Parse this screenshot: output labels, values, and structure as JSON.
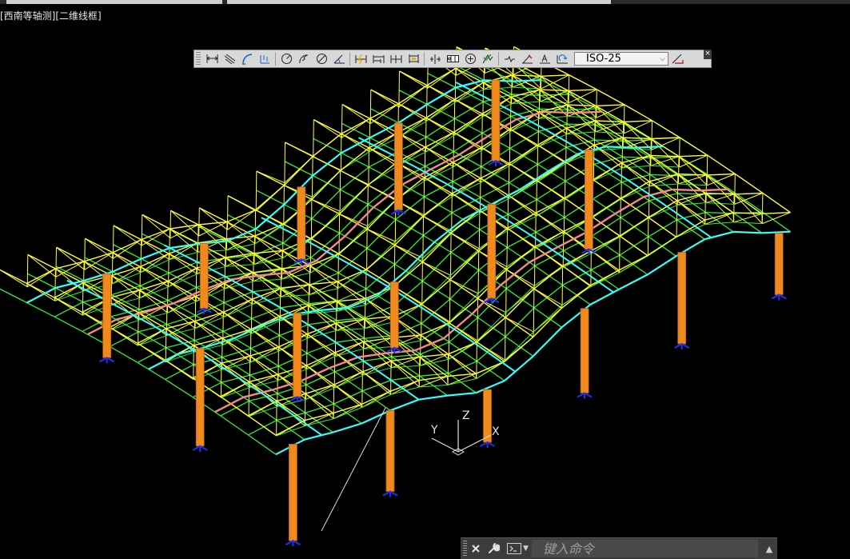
{
  "viewport": {
    "view_name": "[西南等轴测]",
    "visual_style": "[二维线框]"
  },
  "dimension_toolbar": {
    "style_value": "ISO-25",
    "tools": [
      {
        "name": "linear-dimension"
      },
      {
        "name": "aligned-dimension"
      },
      {
        "name": "arc-length-dimension"
      },
      {
        "name": "ordinate-dimension"
      },
      {
        "name": "radius-dimension"
      },
      {
        "name": "jogged-dimension"
      },
      {
        "name": "diameter-dimension"
      },
      {
        "name": "angular-dimension"
      },
      {
        "name": "quick-dimension"
      },
      {
        "name": "baseline-dimension"
      },
      {
        "name": "continue-dimension"
      },
      {
        "name": "dimension-space"
      },
      {
        "name": "dimension-break"
      },
      {
        "name": "tolerance"
      },
      {
        "name": "center-mark"
      },
      {
        "name": "inspection"
      },
      {
        "name": "jogged-linear"
      },
      {
        "name": "dimension-edit"
      },
      {
        "name": "dimension-text-edit"
      },
      {
        "name": "dimension-update"
      },
      {
        "name": "dimension-style"
      }
    ]
  },
  "ucs_icon": {
    "x_label": "X",
    "y_label": "Y",
    "z_label": "Z"
  },
  "command_line": {
    "placeholder": "键入命令"
  },
  "colors": {
    "background": "#000000",
    "truss_yellow": "#ffff33",
    "truss_green": "#33ee33",
    "truss_cyan": "#33ffff",
    "truss_pink": "#f08c8c",
    "column_orange": "#f08a1e",
    "support_blue": "#2030ff"
  }
}
